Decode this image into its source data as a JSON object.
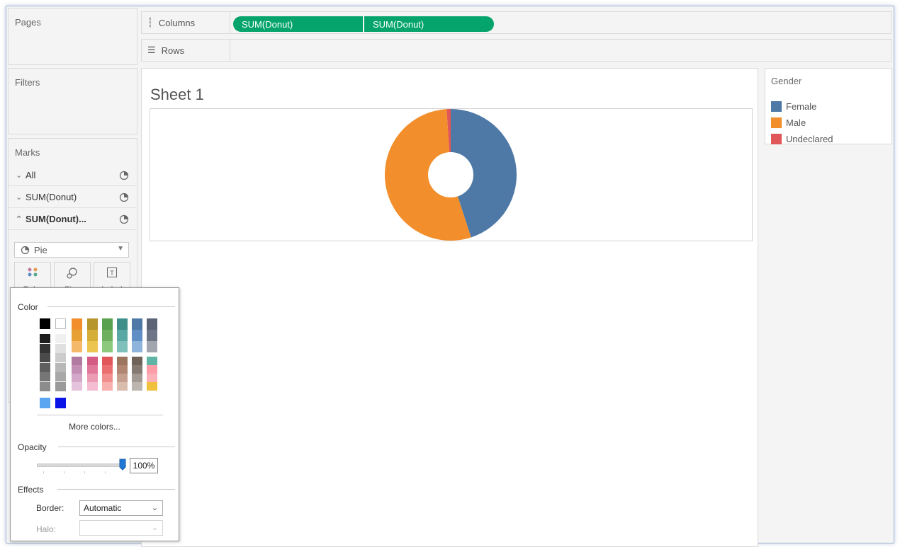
{
  "shelves": {
    "pages_title": "Pages",
    "filters_title": "Filters",
    "columns_label": "Columns",
    "columns_pills": [
      "SUM(Donut)",
      "SUM(Donut)"
    ],
    "rows_label": "Rows"
  },
  "marks": {
    "title": "Marks",
    "cards": [
      {
        "label": "All",
        "chevron": "down",
        "bold": false
      },
      {
        "label": "SUM(Donut)",
        "chevron": "down",
        "bold": false
      },
      {
        "label": "SUM(Donut)...",
        "chevron": "up",
        "bold": true
      }
    ],
    "mark_type": "Pie",
    "buttons": [
      "Color",
      "Size",
      "Label"
    ]
  },
  "sheet": {
    "title": "Sheet 1"
  },
  "legend": {
    "title": "Gender",
    "items": [
      {
        "label": "Female",
        "color": "#4e79a7"
      },
      {
        "label": "Male",
        "color": "#f28e2b"
      },
      {
        "label": "Undeclared",
        "color": "#e15759"
      }
    ]
  },
  "chart_data": {
    "type": "pie",
    "title": "",
    "categories": [
      "Female",
      "Male",
      "Undeclared"
    ],
    "values": [
      45,
      54,
      1
    ],
    "colors": [
      "#4e79a7",
      "#f28e2b",
      "#e15759"
    ],
    "donut_hole": true
  },
  "color_popup": {
    "color_section": "Color",
    "more_colors": "More colors...",
    "opacity_section": "Opacity",
    "opacity_value": "100%",
    "opacity_level": 1.0,
    "effects_section": "Effects",
    "border_label": "Border:",
    "border_value": "Automatic",
    "halo_label": "Halo:",
    "halo_value": "",
    "palette": {
      "gray_col": [
        "#000000",
        "#1e1e1e",
        "#333333",
        "#4a4a4a",
        "#5f5f5f",
        "#767676",
        "#8c8c8c"
      ],
      "light_col": [
        "#ffffff",
        "#f0f0f0",
        "#e0e0e0",
        "#cccccc",
        "#b8b8b8",
        "#a8a8a8",
        "#9a9a9a"
      ],
      "top_cols": [
        [
          "#f28e2b",
          "#e6a033",
          "#f5b96a"
        ],
        [
          "#b8962e",
          "#d4ae37",
          "#ebc54f"
        ],
        [
          "#59a14f",
          "#6fb05f",
          "#8dc97d"
        ],
        [
          "#3e8f8a",
          "#5aa8a3",
          "#7fc0bb"
        ],
        [
          "#4e79a7",
          "#5f8fc4",
          "#8fb4dc"
        ],
        [
          "#5b6477",
          "#6d7586",
          "#a0a5ae"
        ]
      ],
      "bottom_cols": [
        [
          "#b07aa1",
          "#c48fb5",
          "#d4a8c8",
          "#e6c3dc"
        ],
        [
          "#d45b84",
          "#e1789a",
          "#ec9bb5",
          "#f4bcd0"
        ],
        [
          "#e15759",
          "#eb6f70",
          "#f28e8d",
          "#f7b0ae"
        ],
        [
          "#9c755f",
          "#b08672",
          "#c5a08f",
          "#d9bcae"
        ],
        [
          "#6f6259",
          "#857a72",
          "#a29992",
          "#bdb6b0"
        ],
        [
          "#5fb5a5",
          "#ff9da7",
          "#fbb1b8",
          "#f0c13c"
        ]
      ],
      "extra": [
        "#5aa6f0",
        "#0a14e6"
      ]
    }
  }
}
